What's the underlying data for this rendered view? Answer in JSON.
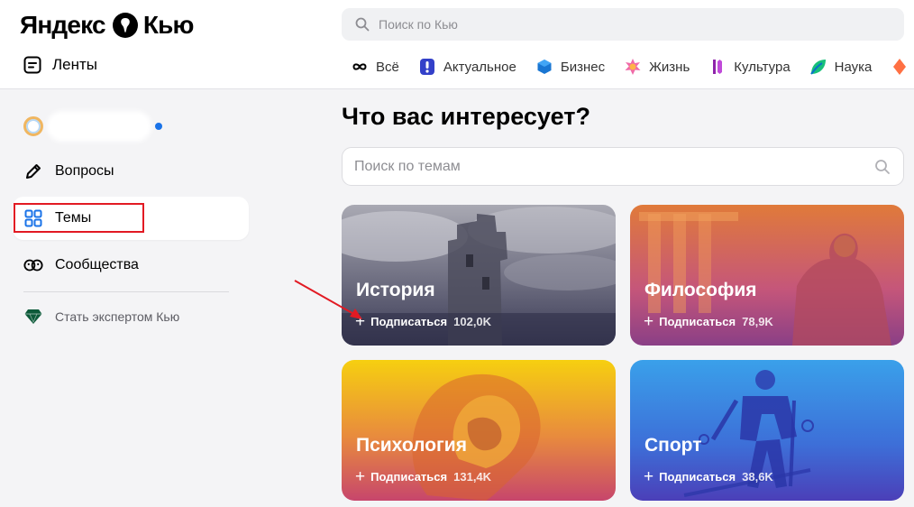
{
  "header": {
    "logo_left": "Яндекс",
    "logo_right": "Кью",
    "feeds_label": "Ленты",
    "search_placeholder": "Поиск по Кью",
    "categories": [
      {
        "label": "Всё",
        "icon": "infinity-icon"
      },
      {
        "label": "Актуальное",
        "icon": "actual-icon"
      },
      {
        "label": "Бизнес",
        "icon": "business-icon"
      },
      {
        "label": "Жизнь",
        "icon": "life-icon"
      },
      {
        "label": "Культура",
        "icon": "culture-icon"
      },
      {
        "label": "Наука",
        "icon": "science-icon"
      }
    ]
  },
  "sidebar": {
    "items": [
      {
        "label": "Вопросы",
        "icon": "pencil-icon"
      },
      {
        "label": "Темы",
        "icon": "grid-icon"
      },
      {
        "label": "Сообщества",
        "icon": "community-icon"
      }
    ],
    "expert_label": "Стать экспертом Кью"
  },
  "main": {
    "title": "Что вас интересует?",
    "topic_search_placeholder": "Поиск по темам",
    "subscribe_label": "Подписаться",
    "topics": [
      {
        "title": "История",
        "count": "102,0K"
      },
      {
        "title": "Философия",
        "count": "78,9K"
      },
      {
        "title": "Психология",
        "count": "131,4K"
      },
      {
        "title": "Спорт",
        "count": "38,6K"
      }
    ]
  },
  "colors": {
    "accent_blue": "#1a73e8",
    "highlight_red": "#e21a23"
  }
}
